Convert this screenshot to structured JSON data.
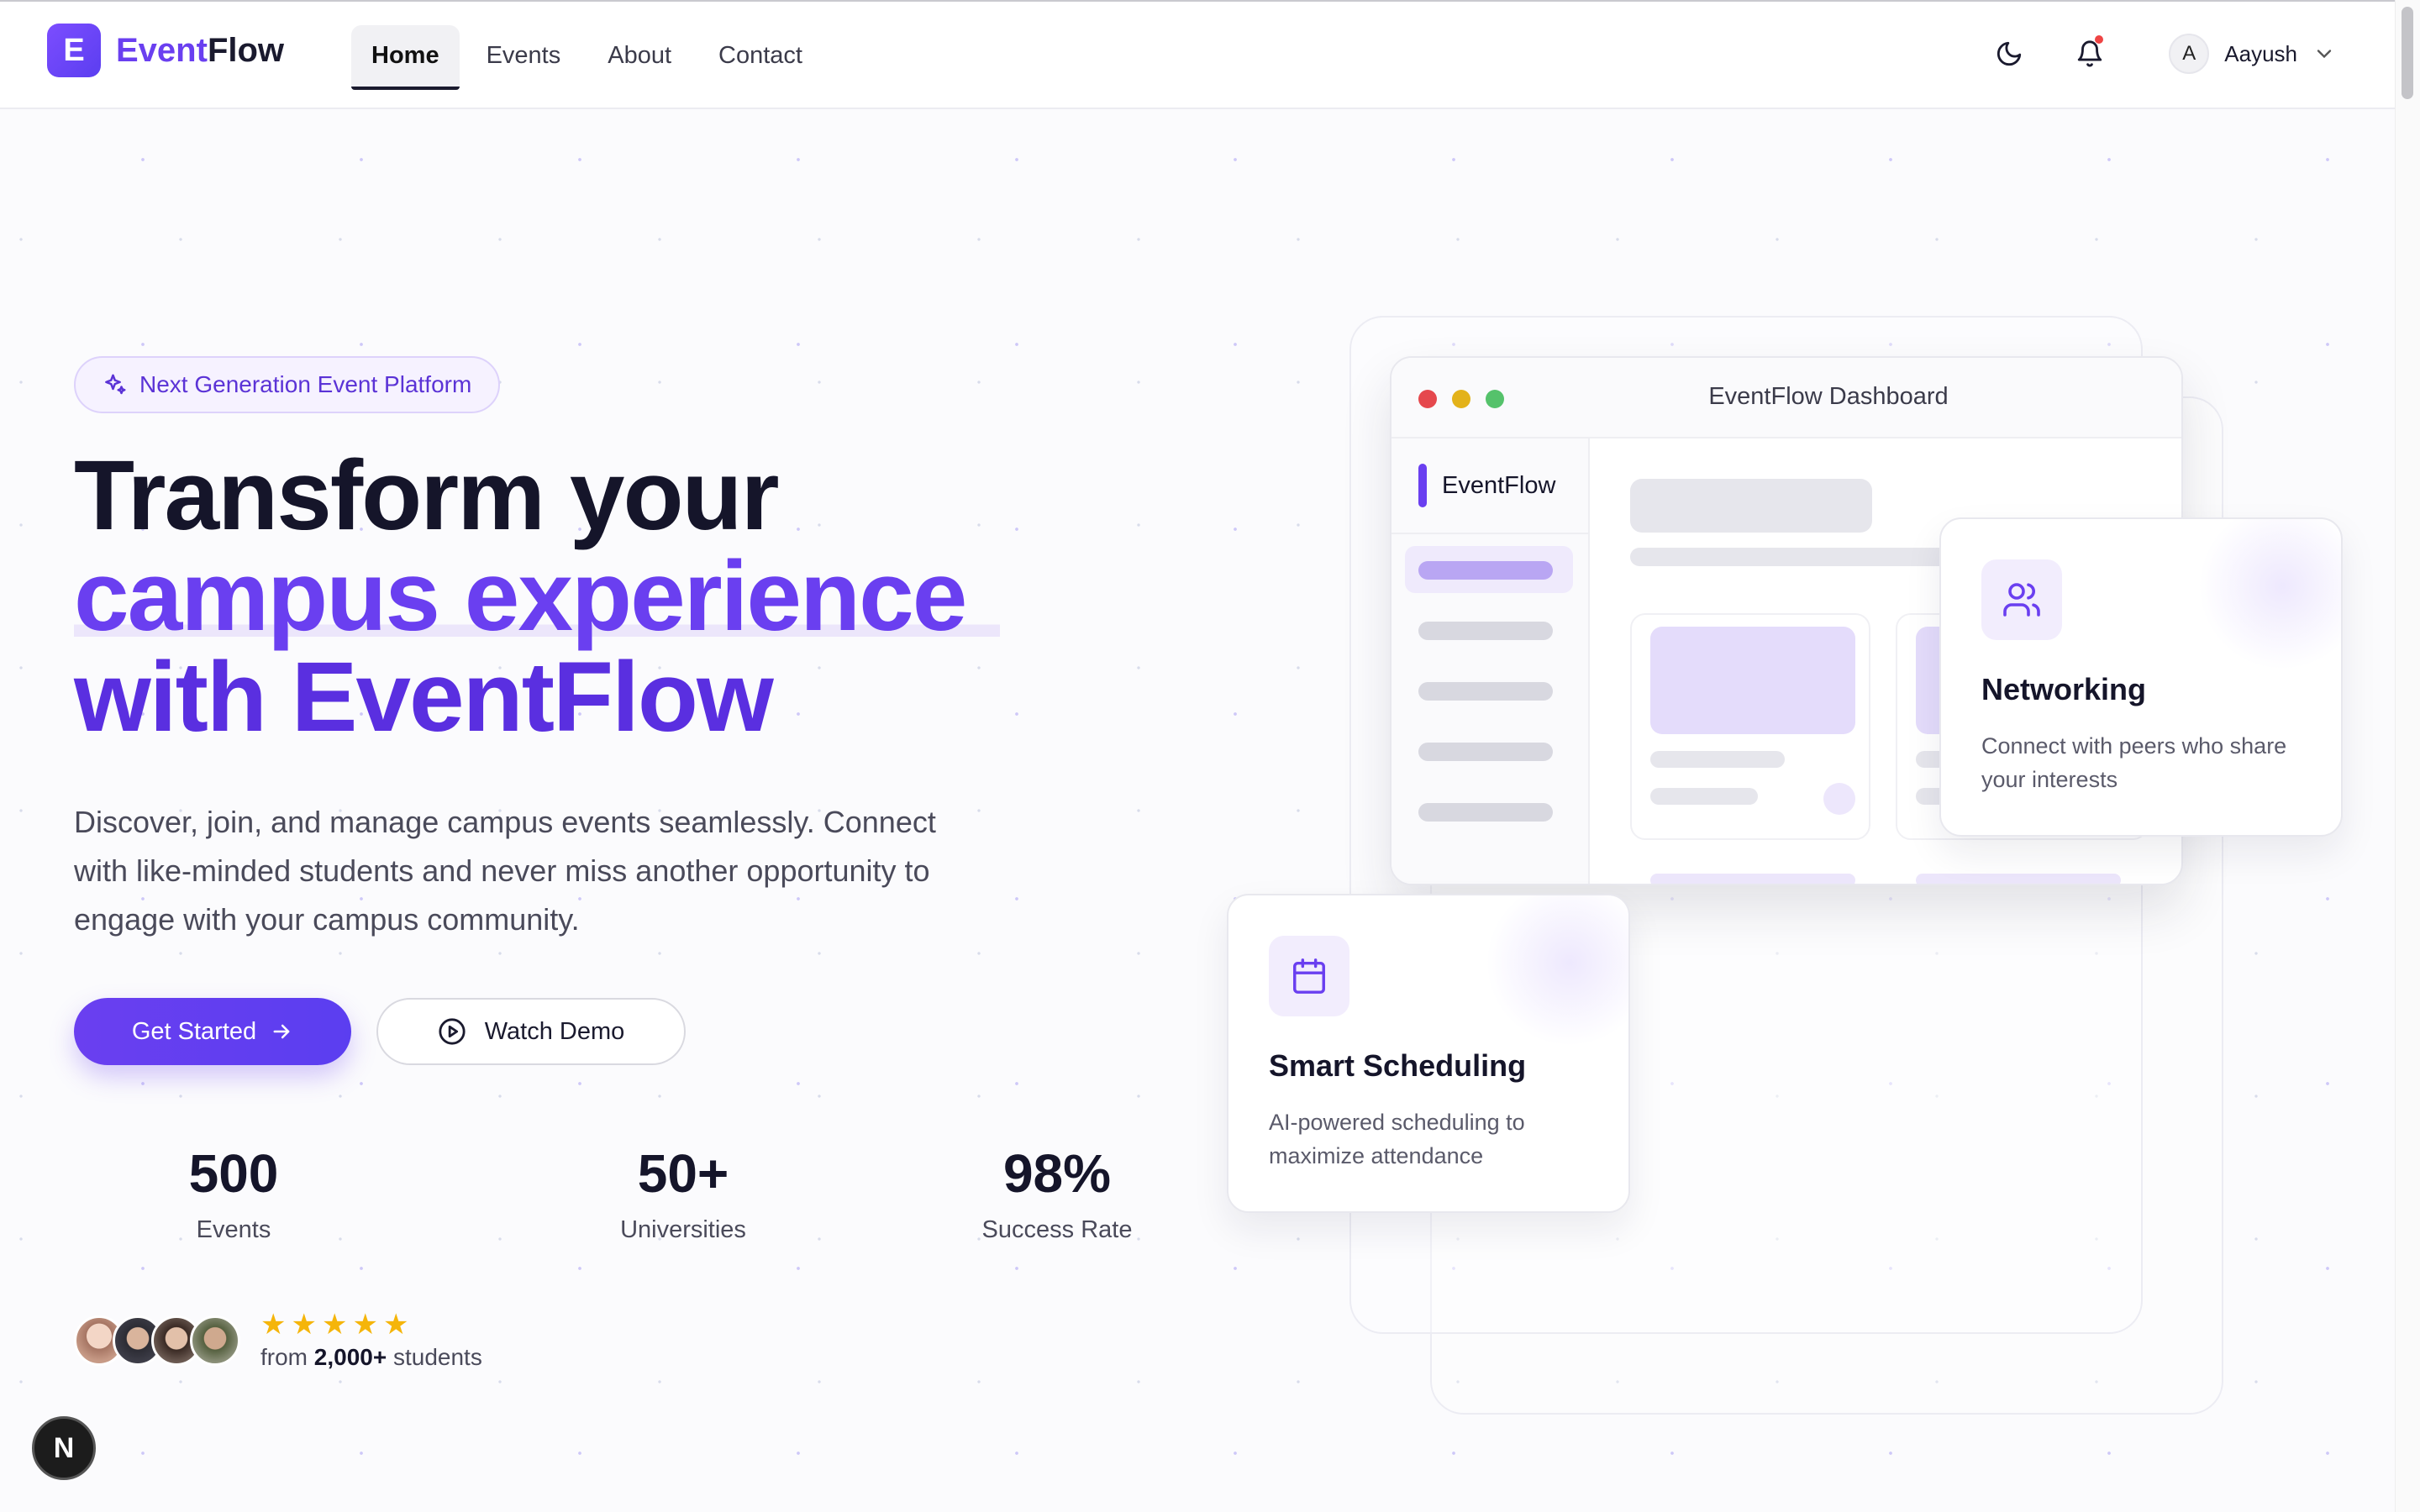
{
  "nav": {
    "logo_letter": "E",
    "logo_part1": "Event",
    "logo_part2": "Flow",
    "menu": [
      {
        "label": "Home"
      },
      {
        "label": "Events"
      },
      {
        "label": "About"
      },
      {
        "label": "Contact"
      }
    ],
    "user": {
      "initial": "A",
      "name": "Aayush"
    }
  },
  "hero": {
    "badge": "Next Generation Event Platform",
    "title_line1": "Transform your",
    "title_line2": "campus experience",
    "title_line3": "with EventFlow",
    "lead": "Discover, join, and manage campus events seamlessly. Connect with like-minded students and never miss another opportunity to engage with your campus community.",
    "cta_primary": "Get Started",
    "cta_secondary": "Watch Demo",
    "stats": [
      {
        "value": "500",
        "label": "Events"
      },
      {
        "value": "50+",
        "label": "Universities"
      },
      {
        "value": "98%",
        "label": "Success Rate"
      }
    ],
    "social_prefix": "from",
    "social_count": "2,000+",
    "social_suffix": "students",
    "rating": 5
  },
  "dashboard": {
    "title": "EventFlow Dashboard",
    "brand": "EventFlow"
  },
  "cards": {
    "networking": {
      "title": "Networking",
      "desc": "Connect with peers who share your interests"
    },
    "scheduling": {
      "title": "Smart Scheduling",
      "desc": "AI-powered scheduling to maximize attendance"
    }
  },
  "dev_badge": "N",
  "colors": {
    "accent": "#6a3ff0",
    "text_dark": "#15152a",
    "star": "#f5b50a",
    "notification": "#ef4444"
  }
}
